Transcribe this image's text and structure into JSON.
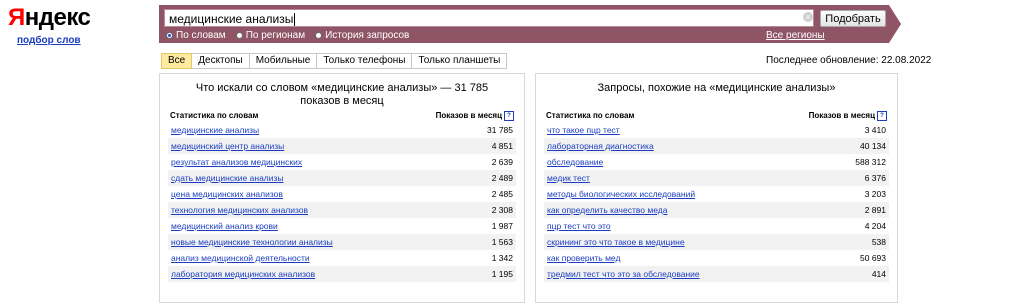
{
  "logo": {
    "first": "Я",
    "rest": "ндекс"
  },
  "logo_sub": "подбор слов",
  "search": {
    "value": "медицинские анализы",
    "submit_label": "Подобрать",
    "clear_glyph": "×"
  },
  "radios": [
    {
      "label": "По словам",
      "checked": true
    },
    {
      "label": "По регионам",
      "checked": false
    },
    {
      "label": "История запросов",
      "checked": false
    }
  ],
  "regions_link": "Все регионы",
  "tabs": [
    "Все",
    "Десктопы",
    "Мобильные",
    "Только телефоны",
    "Только планшеты"
  ],
  "updated": "Последнее обновление: 22.08.2022",
  "left": {
    "title": "Что искали со словом «медицинские анализы» — 31 785 показов в месяц",
    "col_phrase": "Статистика по словам",
    "col_count": "Показов в месяц",
    "help_glyph": "?",
    "rows": [
      {
        "phrase": "медицинские анализы",
        "count": "31 785"
      },
      {
        "phrase": "медицинский центр анализы",
        "count": "4 851"
      },
      {
        "phrase": "результат анализов медицинских",
        "count": "2 639"
      },
      {
        "phrase": "сдать медицинские анализы",
        "count": "2 489"
      },
      {
        "phrase": "цена медицинских анализов",
        "count": "2 485"
      },
      {
        "phrase": "технология медицинских анализов",
        "count": "2 308"
      },
      {
        "phrase": "медицинский анализ крови",
        "count": "1 987"
      },
      {
        "phrase": "новые медицинские технологии анализы",
        "count": "1 563"
      },
      {
        "phrase": "анализ медицинской деятельности",
        "count": "1 342"
      },
      {
        "phrase": "лаборатория медицинских анализов",
        "count": "1 195"
      }
    ]
  },
  "right": {
    "title": "Запросы, похожие на «медицинские анализы»",
    "col_phrase": "Статистика по словам",
    "col_count": "Показов в месяц",
    "help_glyph": "?",
    "rows": [
      {
        "phrase": "что такое пцр тест",
        "count": "3 410"
      },
      {
        "phrase": "лабораторная диагностика",
        "count": "40 134"
      },
      {
        "phrase": "обследование",
        "count": "588 312"
      },
      {
        "phrase": "медик тест",
        "count": "6 376"
      },
      {
        "phrase": "методы биологических исследований",
        "count": "3 203"
      },
      {
        "phrase": "как определить качество меда",
        "count": "2 891"
      },
      {
        "phrase": "пцр тест что это",
        "count": "4 204"
      },
      {
        "phrase": "скрининг это что такое в медицине",
        "count": "538"
      },
      {
        "phrase": "как проверить мед",
        "count": "50 693"
      },
      {
        "phrase": "тредмил тест что это за обследование",
        "count": "414"
      }
    ]
  },
  "colors": {
    "band": "#8f5566",
    "link": "#1a3dc1",
    "active_tab": "#ffeba0",
    "logo_red": "#ff0000"
  }
}
